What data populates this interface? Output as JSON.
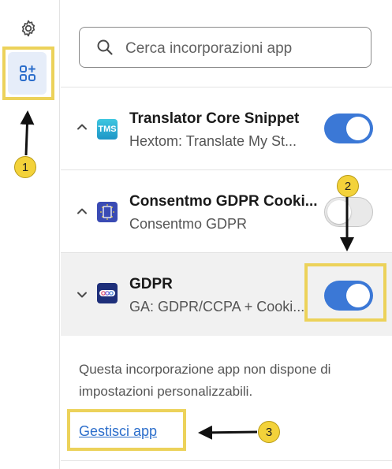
{
  "sidebar": {
    "settings_icon": "gear-icon",
    "apps_icon": "app-embed-icon"
  },
  "search": {
    "placeholder": "Cerca incorporazioni app"
  },
  "apps": [
    {
      "title": "Translator Core Snippet",
      "subtitle": "Hextom: Translate My St...",
      "logo_text": "TMS",
      "enabled": true,
      "expanded": false
    },
    {
      "title": "Consentmo GDPR Cooki...",
      "subtitle": "Consentmo GDPR",
      "enabled": false,
      "expanded": false
    },
    {
      "title": "GDPR",
      "subtitle": "GA: GDPR/CCPA + Cooki...",
      "enabled": true,
      "expanded": true
    }
  ],
  "details": {
    "description": "Questa incorporazione app non dispone di impostazioni personalizzabili.",
    "manage_link": "Gestisci app"
  },
  "annotations": {
    "badge_1": "1",
    "badge_2": "2",
    "badge_3": "3"
  },
  "colors": {
    "accent": "#3b78d6",
    "highlight": "#ecd25a",
    "badge": "#f3d23a",
    "link": "#2c6ecb"
  }
}
